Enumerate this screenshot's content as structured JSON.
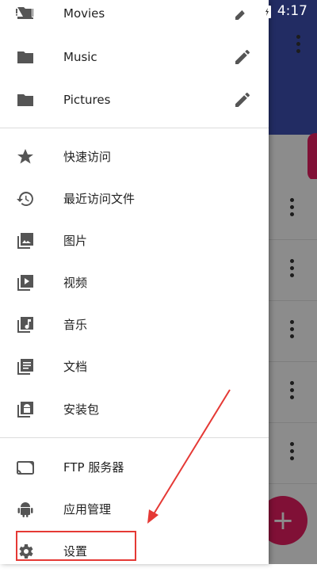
{
  "status_bar": {
    "time": "4:17"
  },
  "drawer": {
    "partial_item": {
      "label": "Movies"
    },
    "bookmarks": [
      {
        "label": "Music",
        "icon": "folder-icon",
        "edit_icon": "edit-pencil-icon"
      },
      {
        "label": "Pictures",
        "icon": "folder-icon",
        "edit_icon": "edit-pencil-icon"
      }
    ],
    "quick": [
      {
        "label": "快速访问",
        "icon": "star-icon"
      },
      {
        "label": "最近访问文件",
        "icon": "history-icon"
      },
      {
        "label": "图片",
        "icon": "image-icon"
      },
      {
        "label": "视频",
        "icon": "video-icon"
      },
      {
        "label": "音乐",
        "icon": "music-icon"
      },
      {
        "label": "文档",
        "icon": "document-icon"
      },
      {
        "label": "安装包",
        "icon": "android-package-icon"
      }
    ],
    "tools": [
      {
        "label": "FTP 服务器",
        "icon": "ftp-server-icon"
      },
      {
        "label": "应用管理",
        "icon": "android-icon"
      },
      {
        "label": "设置",
        "icon": "gear-icon"
      }
    ]
  },
  "background": {
    "fab_symbol": "+"
  },
  "colors": {
    "toolbar": "#3f51b5",
    "accent": "#e91e63",
    "annotation": "#e53935"
  }
}
